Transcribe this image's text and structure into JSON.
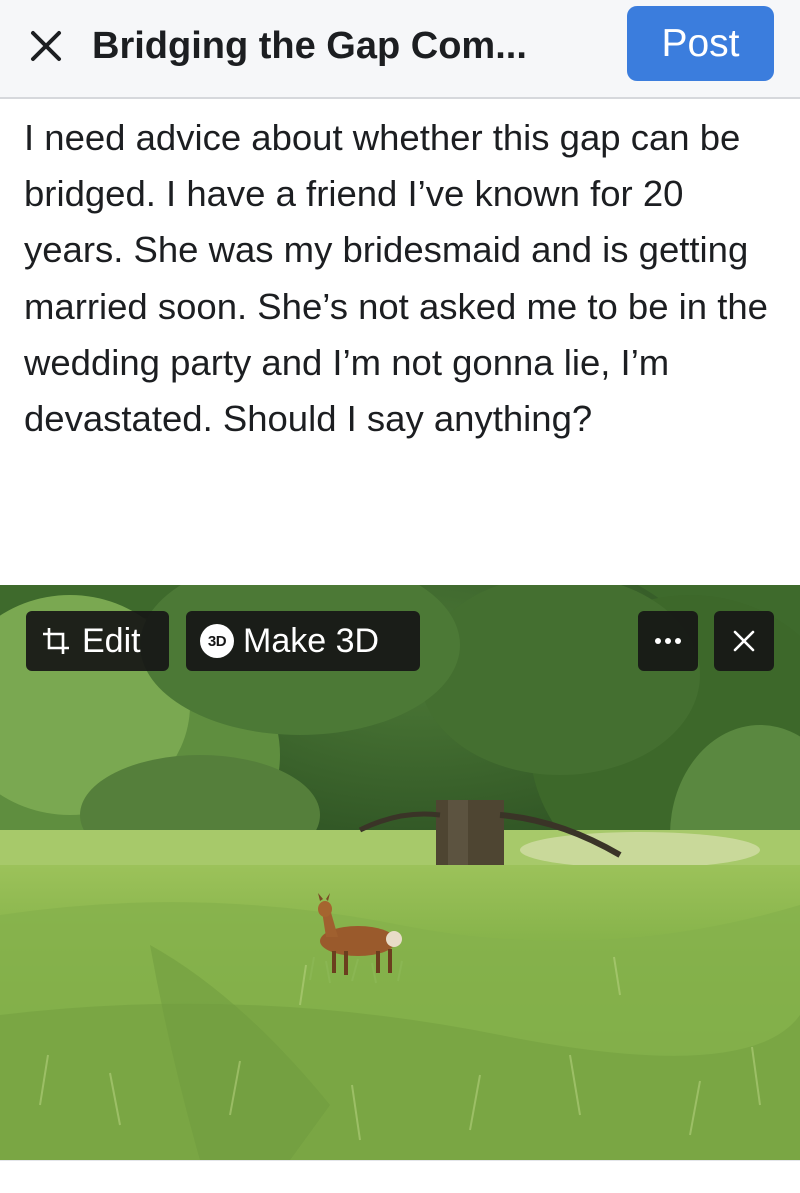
{
  "header": {
    "close_icon": "close-icon",
    "title": "Bridging the Gap Com...",
    "post_label": "Post",
    "post_color": "#3b7ddd"
  },
  "post": {
    "text": "I need advice about whether this gap can be bridged. I have a friend I’ve known for 20 years. She was my bridesmaid and is getting married soon. She’s not asked me to be in the wedding party and I’m not gonna lie, I’m devastated. Should I say anything?"
  },
  "photo": {
    "edit_icon": "crop-icon",
    "edit_label": "Edit",
    "make3d_icon": "3d-icon",
    "make3d_badge": "3D",
    "make3d_label": "Make 3D",
    "more_icon": "more-icon",
    "remove_icon": "close-icon"
  }
}
